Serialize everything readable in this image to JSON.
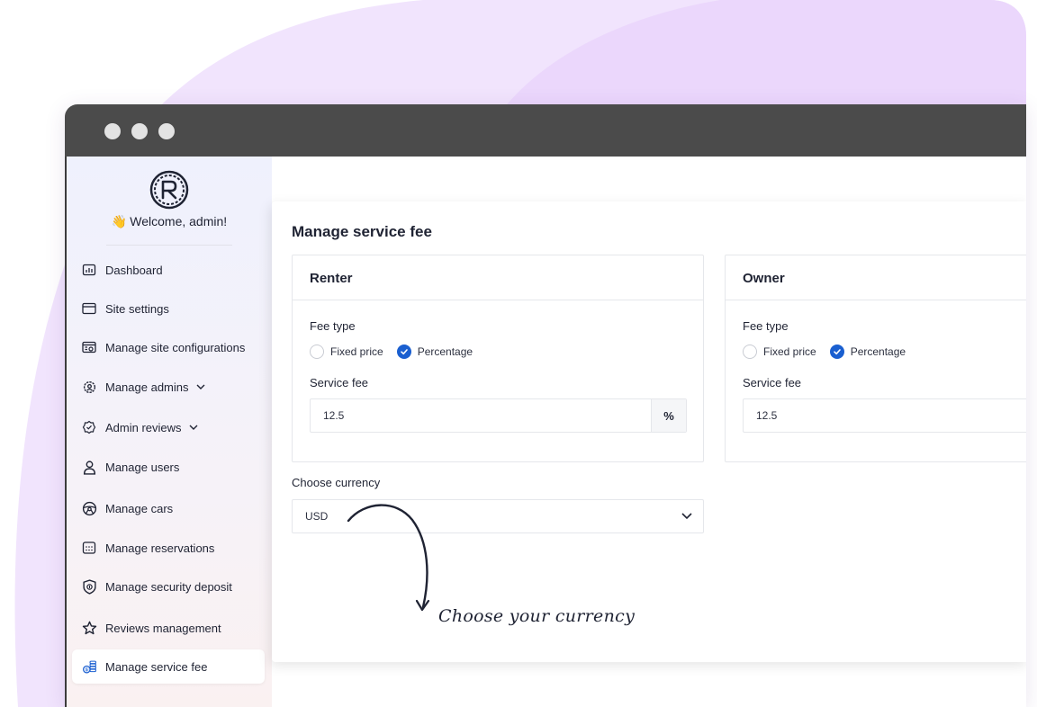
{
  "colors": {
    "accent": "#1a5fd0",
    "bg_blob": "#f1e4fd",
    "titlebar": "#4b4b4b"
  },
  "sidebar": {
    "logo_icon": "brand-logo-icon",
    "welcome_emoji": "👋",
    "welcome_text": "Welcome, admin!",
    "items": [
      {
        "label": "Dashboard",
        "icon": "chart-icon"
      },
      {
        "label": "Site settings",
        "icon": "browser-icon"
      },
      {
        "label": "Manage site configurations",
        "icon": "config-icon"
      },
      {
        "label": "Manage admins",
        "icon": "gear-user-icon",
        "expandable": true
      },
      {
        "label": "Admin reviews",
        "icon": "badge-check-icon",
        "expandable": true
      },
      {
        "label": "Manage users",
        "icon": "user-icon"
      },
      {
        "label": "Manage cars",
        "icon": "steering-wheel-icon"
      },
      {
        "label": "Manage reservations",
        "icon": "calendar-icon"
      },
      {
        "label": "Manage security deposit",
        "icon": "shield-icon"
      },
      {
        "label": "Reviews management",
        "icon": "star-icon"
      },
      {
        "label": "Manage service fee",
        "icon": "coins-icon",
        "active": true
      }
    ]
  },
  "main": {
    "title": "Manage service fee",
    "renter": {
      "title": "Renter",
      "fee_type_label": "Fee type",
      "option_fixed": "Fixed price",
      "option_percentage": "Percentage",
      "selected": "Percentage",
      "service_fee_label": "Service fee",
      "service_fee_value": "12.5",
      "unit": "%"
    },
    "owner": {
      "title": "Owner",
      "fee_type_label": "Fee type",
      "option_fixed": "Fixed price",
      "option_percentage": "Percentage",
      "selected": "Percentage",
      "service_fee_label": "Service fee",
      "service_fee_value": "12.5"
    },
    "currency": {
      "label": "Choose currency",
      "value": "USD"
    }
  },
  "annotation": {
    "text": "Choose your currency"
  }
}
